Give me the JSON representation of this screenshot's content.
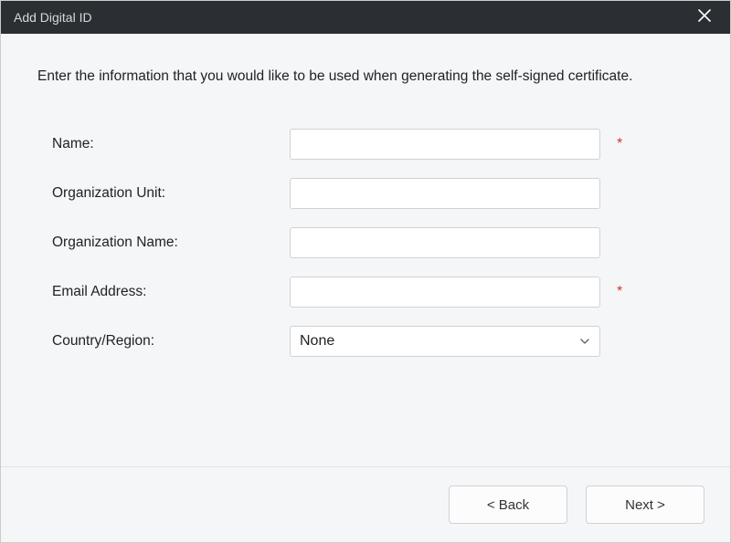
{
  "titlebar": {
    "title": "Add Digital ID"
  },
  "instruction": "Enter the information that you would like to be used when generating the self-signed certificate.",
  "form": {
    "name": {
      "label": "Name:",
      "value": "",
      "required": "*"
    },
    "orgUnit": {
      "label": "Organization Unit:",
      "value": ""
    },
    "orgName": {
      "label": "Organization Name:",
      "value": ""
    },
    "email": {
      "label": "Email Address:",
      "value": "",
      "required": "*"
    },
    "country": {
      "label": "Country/Region:",
      "value": "None"
    }
  },
  "footer": {
    "back": "< Back",
    "next": "Next >"
  }
}
